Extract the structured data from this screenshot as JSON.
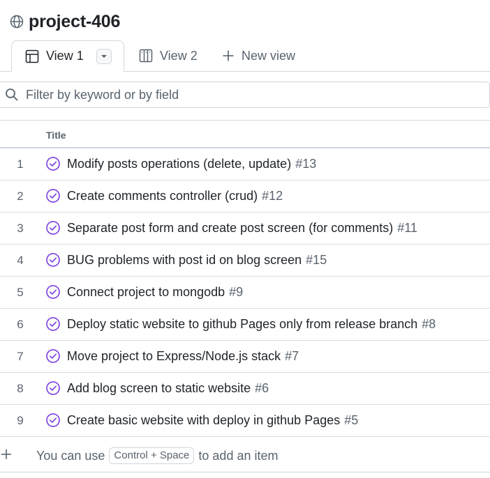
{
  "project": {
    "title": "project-406",
    "icon": "globe-icon"
  },
  "tabs": {
    "view1": {
      "label": "View 1",
      "icon": "table-icon"
    },
    "view2": {
      "label": "View 2",
      "icon": "board-icon"
    },
    "new_view": {
      "label": "New view",
      "icon": "plus-icon"
    }
  },
  "filter": {
    "placeholder": "Filter by keyword or by field",
    "value": ""
  },
  "table": {
    "column_title": "Title",
    "rows": [
      {
        "num": "1",
        "title": "Modify posts operations (delete, update)",
        "issue": "#13"
      },
      {
        "num": "2",
        "title": "Create comments controller (crud)",
        "issue": "#12"
      },
      {
        "num": "3",
        "title": "Separate post form and create post screen (for comments)",
        "issue": "#11"
      },
      {
        "num": "4",
        "title": "BUG problems with post id on blog screen",
        "issue": "#15"
      },
      {
        "num": "5",
        "title": "Connect project to mongodb",
        "issue": "#9"
      },
      {
        "num": "6",
        "title": "Deploy static website to github Pages only from release branch",
        "issue": "#8"
      },
      {
        "num": "7",
        "title": "Move project to Express/Node.js stack",
        "issue": "#7"
      },
      {
        "num": "8",
        "title": "Add blog screen to static website",
        "issue": "#6"
      },
      {
        "num": "9",
        "title": "Create basic website with deploy in github Pages",
        "issue": "#5"
      }
    ]
  },
  "add_item": {
    "prefix": "You can use",
    "shortcut": "Control + Space",
    "suffix": "to add an item"
  },
  "colors": {
    "accent": "#8250df",
    "border": "#d0d7de",
    "muted": "#59636e",
    "text": "#1f2328"
  }
}
